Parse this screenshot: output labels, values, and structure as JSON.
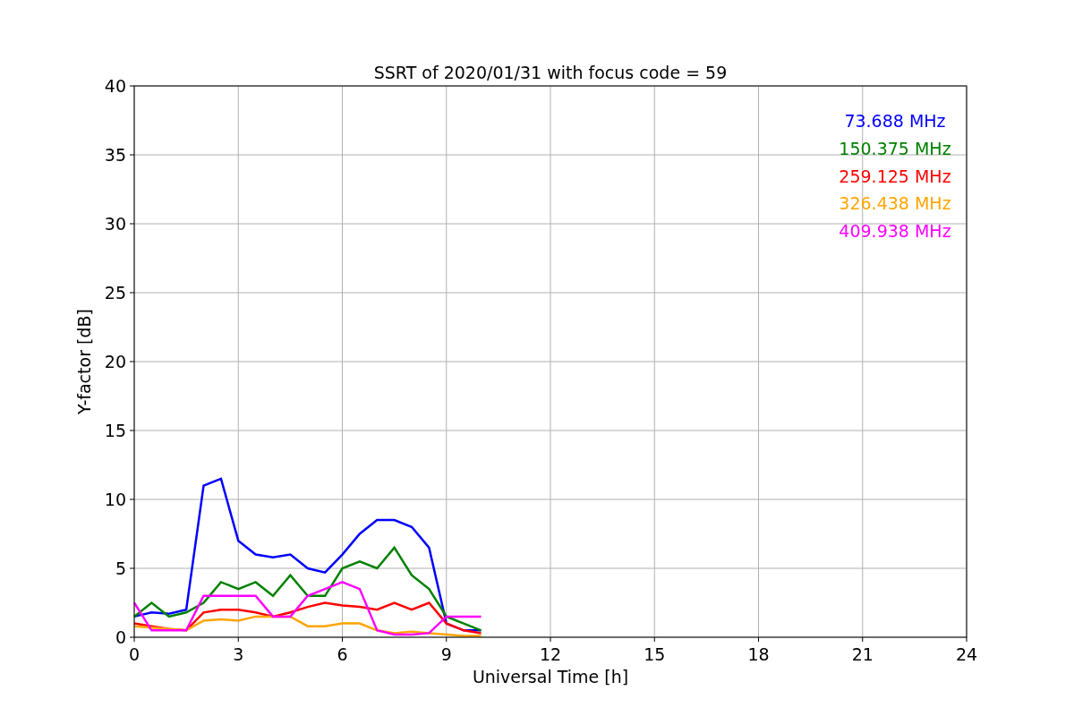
{
  "chart_data": {
    "type": "line",
    "title": "SSRT of 2020/01/31 with focus code = 59",
    "xlabel": "Universal Time [h]",
    "ylabel": "Y-factor [dB]",
    "x": [
      0,
      0.5,
      1,
      1.5,
      2,
      2.5,
      3,
      3.5,
      4,
      4.5,
      5,
      5.5,
      6,
      6.5,
      7,
      7.5,
      8,
      8.5,
      9,
      9.5,
      10
    ],
    "series": [
      {
        "name": "73.688 MHz",
        "color": "#0000ff",
        "values": [
          1.5,
          1.8,
          1.7,
          2,
          11,
          11.5,
          7,
          6,
          5.8,
          6,
          5,
          4.7,
          6,
          7.5,
          8.5,
          8.5,
          8,
          6.5,
          1,
          0.5,
          0.5
        ]
      },
      {
        "name": "150.375 MHz",
        "color": "#008000",
        "values": [
          1.5,
          2.5,
          1.5,
          1.8,
          2.5,
          4,
          3.5,
          4,
          3,
          4.5,
          3,
          3,
          5,
          5.5,
          5,
          6.5,
          4.5,
          3.5,
          1.5,
          1,
          0.5
        ]
      },
      {
        "name": "259.125 MHz",
        "color": "#ff0000",
        "values": [
          1,
          0.8,
          0.6,
          0.5,
          1.8,
          2,
          2,
          1.8,
          1.5,
          1.8,
          2.2,
          2.5,
          2.3,
          2.2,
          2,
          2.5,
          2,
          2.5,
          1,
          0.5,
          0.3
        ]
      },
      {
        "name": "326.438 MHz",
        "color": "#ffa500",
        "values": [
          0.8,
          0.7,
          0.6,
          0.5,
          1.2,
          1.3,
          1.2,
          1.5,
          1.5,
          1.5,
          0.8,
          0.8,
          1,
          1,
          0.5,
          0.3,
          0.4,
          0.3,
          0.2,
          0.1,
          0.1
        ]
      },
      {
        "name": "409.938 MHz",
        "color": "#ff00ff",
        "values": [
          2.5,
          0.5,
          0.5,
          0.5,
          3,
          3,
          3,
          3,
          1.5,
          1.5,
          3,
          3.5,
          4,
          3.5,
          0.5,
          0.2,
          0.2,
          0.3,
          1.5,
          1.5,
          1.5
        ]
      }
    ],
    "grid": true,
    "xlim": [
      0,
      24
    ],
    "ylim": [
      0,
      40
    ],
    "xticks": [
      0,
      3,
      6,
      9,
      12,
      15,
      18,
      21,
      24
    ],
    "yticks": [
      0,
      5,
      10,
      15,
      20,
      25,
      30,
      35,
      40
    ]
  }
}
